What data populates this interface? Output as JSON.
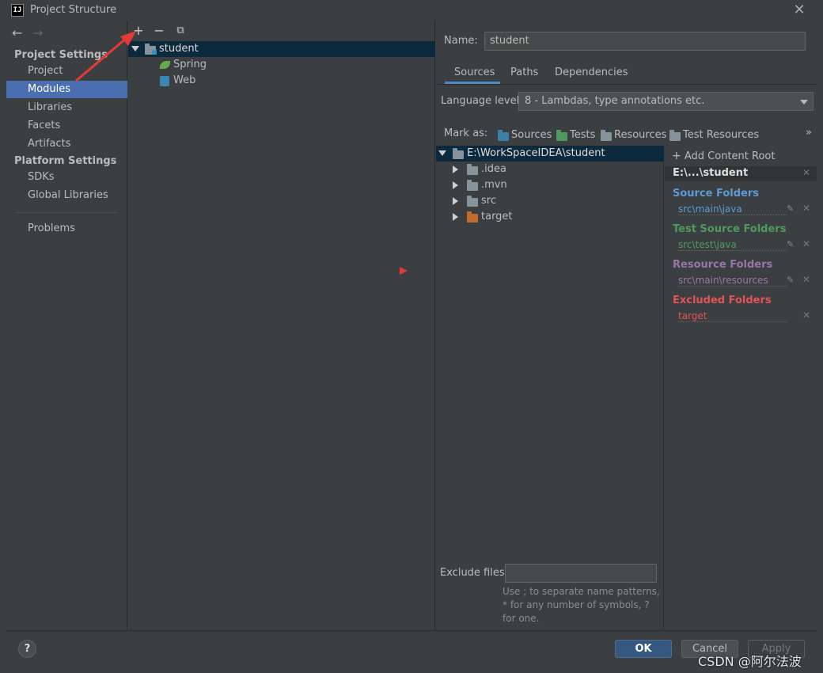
{
  "window": {
    "title": "Project Structure"
  },
  "sidebar": {
    "project_settings_header": "Project Settings",
    "platform_settings_header": "Platform Settings",
    "items": [
      {
        "label": "Project",
        "selected": false
      },
      {
        "label": "Modules",
        "selected": true
      },
      {
        "label": "Libraries",
        "selected": false
      },
      {
        "label": "Facets",
        "selected": false
      },
      {
        "label": "Artifacts",
        "selected": false
      },
      {
        "label": "SDKs",
        "selected": false
      },
      {
        "label": "Global Libraries",
        "selected": false
      },
      {
        "label": "Problems",
        "selected": false
      }
    ]
  },
  "module_tree": {
    "root": "student",
    "children": [
      "Spring",
      "Web"
    ]
  },
  "module": {
    "name_label": "Name:",
    "name_value": "student",
    "tabs": [
      "Sources",
      "Paths",
      "Dependencies"
    ],
    "active_tab": "Sources",
    "language_level_label": "Language level:",
    "language_level_value": "8 - Lambdas, type annotations etc.",
    "mark_as_label": "Mark as:",
    "mark_as": [
      "Sources",
      "Tests",
      "Resources",
      "Test Resources"
    ],
    "mark_as_more": "»"
  },
  "content_tree": {
    "root": "E:\\WorkSpaceIDEA\\student",
    "children": [
      ".idea",
      ".mvn",
      "src",
      "target"
    ]
  },
  "content_roots": {
    "add_label": "Add Content Root",
    "root_path": "E:\\...\\student",
    "categories": [
      {
        "title": "Source Folders",
        "path": "src\\main\\java",
        "color": "#5a9bd5"
      },
      {
        "title": "Test Source Folders",
        "path": "src\\test\\java",
        "color": "#4e9a5e"
      },
      {
        "title": "Resource Folders",
        "path": "src\\main\\resources",
        "color": "#9876aa"
      },
      {
        "title": "Excluded Folders",
        "path": "target",
        "color": "#e05555"
      }
    ]
  },
  "exclude": {
    "label": "Exclude files:",
    "value": "",
    "hint_lines": [
      "Use ; to separate name patterns,",
      "* for any number of symbols, ?",
      "for one."
    ]
  },
  "buttons": {
    "help": "?",
    "ok": "OK",
    "cancel": "Cancel",
    "apply": "Apply"
  },
  "watermark": "CSDN @阿尔法波",
  "colors": {
    "selection": "#4b6eaf",
    "tree_selection": "#0d293e",
    "ok_button": "#365880",
    "annotation_arrow": "#e53935"
  }
}
